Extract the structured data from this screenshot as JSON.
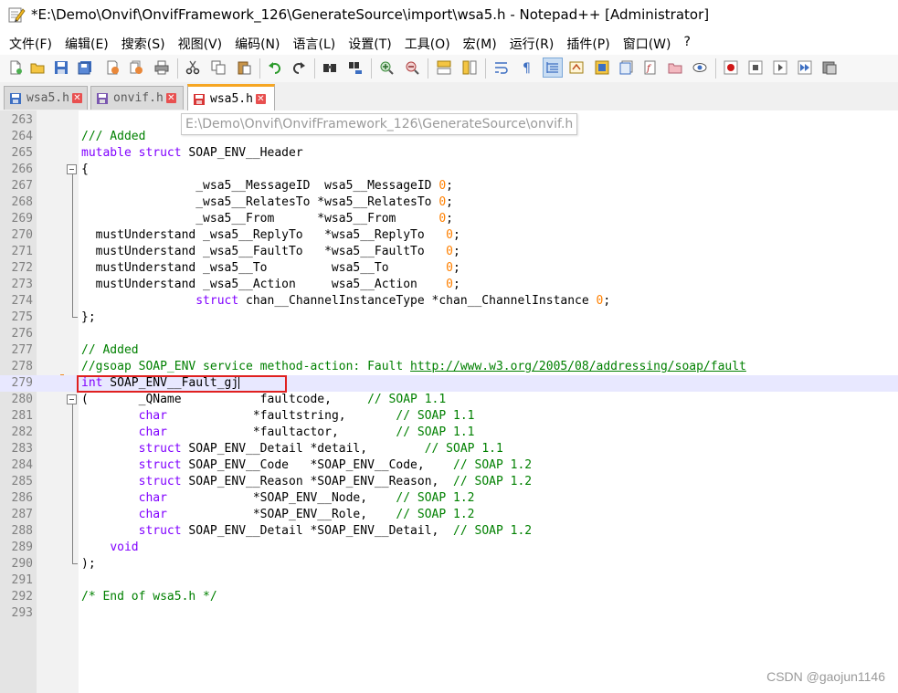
{
  "window": {
    "title": "*E:\\Demo\\Onvif\\OnvifFramework_126\\GenerateSource\\import\\wsa5.h - Notepad++ [Administrator]"
  },
  "menu": [
    "文件(F)",
    "编辑(E)",
    "搜索(S)",
    "视图(V)",
    "编码(N)",
    "语言(L)",
    "设置(T)",
    "工具(O)",
    "宏(M)",
    "运行(R)",
    "插件(P)",
    "窗口(W)",
    "?"
  ],
  "tabs": [
    {
      "name": "wsa5.h",
      "active": false
    },
    {
      "name": "onvif.h",
      "active": false
    },
    {
      "name": "wsa5.h",
      "active": true
    }
  ],
  "tooltip": "E:\\Demo\\Onvif\\OnvifFramework_126\\GenerateSource\\onvif.h",
  "editor": {
    "current_line": 279,
    "lines": [
      {
        "n": "263",
        "t": []
      },
      {
        "n": "264",
        "t": [
          [
            "cmt",
            "/// Added"
          ]
        ]
      },
      {
        "n": "265",
        "t": [
          [
            "kw",
            "mutable"
          ],
          [
            "id",
            " "
          ],
          [
            "kw",
            "struct"
          ],
          [
            "id",
            " SOAP_ENV__Header"
          ]
        ]
      },
      {
        "n": "266",
        "t": [
          [
            "id",
            "{"
          ]
        ]
      },
      {
        "n": "267",
        "t": [
          [
            "id",
            "                _wsa5__MessageID  wsa5__MessageID "
          ],
          [
            "num",
            "0"
          ],
          [
            "id",
            ";"
          ]
        ]
      },
      {
        "n": "268",
        "t": [
          [
            "id",
            "                _wsa5__RelatesTo *wsa5__RelatesTo "
          ],
          [
            "num",
            "0"
          ],
          [
            "id",
            ";"
          ]
        ]
      },
      {
        "n": "269",
        "t": [
          [
            "id",
            "                _wsa5__From      *wsa5__From      "
          ],
          [
            "num",
            "0"
          ],
          [
            "id",
            ";"
          ]
        ]
      },
      {
        "n": "270",
        "t": [
          [
            "id",
            "  mustUnderstand _wsa5__ReplyTo   *wsa5__ReplyTo   "
          ],
          [
            "num",
            "0"
          ],
          [
            "id",
            ";"
          ]
        ]
      },
      {
        "n": "271",
        "t": [
          [
            "id",
            "  mustUnderstand _wsa5__FaultTo   *wsa5__FaultTo   "
          ],
          [
            "num",
            "0"
          ],
          [
            "id",
            ";"
          ]
        ]
      },
      {
        "n": "272",
        "t": [
          [
            "id",
            "  mustUnderstand _wsa5__To         wsa5__To        "
          ],
          [
            "num",
            "0"
          ],
          [
            "id",
            ";"
          ]
        ]
      },
      {
        "n": "273",
        "t": [
          [
            "id",
            "  mustUnderstand _wsa5__Action     wsa5__Action    "
          ],
          [
            "num",
            "0"
          ],
          [
            "id",
            ";"
          ]
        ]
      },
      {
        "n": "274",
        "t": [
          [
            "id",
            "                "
          ],
          [
            "kw",
            "struct"
          ],
          [
            "id",
            " chan__ChannelInstanceType *chan__ChannelInstance "
          ],
          [
            "num",
            "0"
          ],
          [
            "id",
            ";"
          ]
        ]
      },
      {
        "n": "275",
        "t": [
          [
            "id",
            "};"
          ]
        ]
      },
      {
        "n": "276",
        "t": []
      },
      {
        "n": "277",
        "t": [
          [
            "cmt",
            "// Added"
          ]
        ]
      },
      {
        "n": "278",
        "t": [
          [
            "cmt",
            "//gsoap SOAP_ENV service method-action: Fault "
          ],
          [
            "url",
            "http://www.w3.org/2005/08/addressing/soap/fault"
          ]
        ]
      },
      {
        "n": "279",
        "t": [
          [
            "kw",
            "int"
          ],
          [
            "id",
            " SOAP_ENV__Fault_gj"
          ]
        ]
      },
      {
        "n": "280",
        "t": [
          [
            "id",
            "(       _QName           faultcode,     "
          ],
          [
            "cmt",
            "// SOAP 1.1"
          ]
        ]
      },
      {
        "n": "281",
        "t": [
          [
            "id",
            "        "
          ],
          [
            "kw",
            "char"
          ],
          [
            "id",
            "            *faultstring,       "
          ],
          [
            "cmt",
            "// SOAP 1.1"
          ]
        ]
      },
      {
        "n": "282",
        "t": [
          [
            "id",
            "        "
          ],
          [
            "kw",
            "char"
          ],
          [
            "id",
            "            *faultactor,        "
          ],
          [
            "cmt",
            "// SOAP 1.1"
          ]
        ]
      },
      {
        "n": "283",
        "t": [
          [
            "id",
            "        "
          ],
          [
            "kw",
            "struct"
          ],
          [
            "id",
            " SOAP_ENV__Detail *detail,        "
          ],
          [
            "cmt",
            "// SOAP 1.1"
          ]
        ]
      },
      {
        "n": "284",
        "t": [
          [
            "id",
            "        "
          ],
          [
            "kw",
            "struct"
          ],
          [
            "id",
            " SOAP_ENV__Code   *SOAP_ENV__Code,    "
          ],
          [
            "cmt",
            "// SOAP 1.2"
          ]
        ]
      },
      {
        "n": "285",
        "t": [
          [
            "id",
            "        "
          ],
          [
            "kw",
            "struct"
          ],
          [
            "id",
            " SOAP_ENV__Reason *SOAP_ENV__Reason,  "
          ],
          [
            "cmt",
            "// SOAP 1.2"
          ]
        ]
      },
      {
        "n": "286",
        "t": [
          [
            "id",
            "        "
          ],
          [
            "kw",
            "char"
          ],
          [
            "id",
            "            *SOAP_ENV__Node,    "
          ],
          [
            "cmt",
            "// SOAP 1.2"
          ]
        ]
      },
      {
        "n": "287",
        "t": [
          [
            "id",
            "        "
          ],
          [
            "kw",
            "char"
          ],
          [
            "id",
            "            *SOAP_ENV__Role,    "
          ],
          [
            "cmt",
            "// SOAP 1.2"
          ]
        ]
      },
      {
        "n": "288",
        "t": [
          [
            "id",
            "        "
          ],
          [
            "kw",
            "struct"
          ],
          [
            "id",
            " SOAP_ENV__Detail *SOAP_ENV__Detail,  "
          ],
          [
            "cmt",
            "// SOAP 1.2"
          ]
        ]
      },
      {
        "n": "289",
        "t": [
          [
            "id",
            "    "
          ],
          [
            "kw",
            "void"
          ]
        ]
      },
      {
        "n": "290",
        "t": [
          [
            "id",
            ");"
          ]
        ]
      },
      {
        "n": "291",
        "t": []
      },
      {
        "n": "292",
        "t": [
          [
            "cmt",
            "/* End of wsa5.h */"
          ]
        ]
      },
      {
        "n": "293",
        "t": []
      }
    ]
  },
  "watermark": "CSDN @gaojun1146",
  "colors": {
    "keyword": "#8000ff",
    "comment": "#008000",
    "number": "#ff8000",
    "current_line": "#e8e8ff",
    "highlight_box": "#e02020",
    "tab_accent": "#f6a623"
  }
}
